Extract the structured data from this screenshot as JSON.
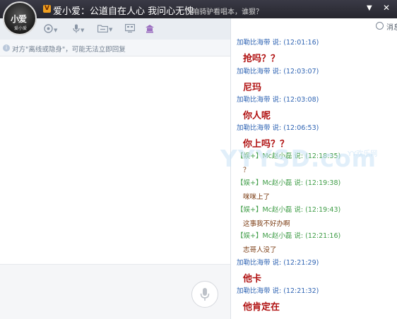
{
  "title_bar": {
    "avatar_text_line1": "小爱",
    "avatar_text_line2": "爱小爱",
    "vip_badge": "V",
    "nickname": "爱小爱：公道自在人心 我问心无愧",
    "signature": "咱骑驴看唱本，谁狠？",
    "menu_glyph": "▼",
    "close_glyph": "✕"
  },
  "toolbar": {
    "icons": [
      "emoji-icon",
      "voice-icon",
      "folder-icon",
      "screenshot-icon",
      "game-icon"
    ]
  },
  "notice": {
    "text": "对方\"离线或隐身\"，可能无法立即回复"
  },
  "history_header": {
    "label": "消息"
  },
  "messages": [
    {
      "sender": "加勒比海带",
      "time": "12:01:16",
      "text": "抢吗？？",
      "style": "big",
      "color": "blue"
    },
    {
      "sender": "加勒比海带",
      "time": "12:03:07",
      "text": "尼玛",
      "style": "big",
      "color": "blue"
    },
    {
      "sender": "加勒比海带",
      "time": "12:03:08",
      "text": "你人呢",
      "style": "big",
      "color": "blue"
    },
    {
      "sender": "加勒比海带",
      "time": "12:06:53",
      "text": "你上吗？？",
      "style": "big",
      "color": "blue"
    },
    {
      "sender": "【娱+】Mc赵小磊",
      "time": "12:18:35",
      "text": "？",
      "style": "small",
      "color": "green"
    },
    {
      "sender": "【娱+】Mc赵小磊",
      "time": "12:19:38",
      "text": "咪咪上了",
      "style": "small",
      "color": "green"
    },
    {
      "sender": "【娱+】Mc赵小磊",
      "time": "12:19:43",
      "text": "这事我不好办啊",
      "style": "small",
      "color": "green"
    },
    {
      "sender": "【娱+】Mc赵小磊",
      "time": "12:21:16",
      "text": "志哥人没了",
      "style": "small",
      "color": "green"
    },
    {
      "sender": "加勒比海带",
      "time": "12:21:29",
      "text": "他卡",
      "style": "big",
      "color": "blue"
    },
    {
      "sender": "加勒比海带",
      "time": "12:21:32",
      "text": "他肯定在",
      "style": "big",
      "color": "blue"
    }
  ],
  "watermark": {
    "main": "YYYSD.com",
    "sub": "YY欢乐网"
  },
  "colors": {
    "titlebar": "#2e2e38",
    "sender_blue": "#2f64b3",
    "sender_green": "#3e9c46",
    "message_red": "#b01010"
  }
}
